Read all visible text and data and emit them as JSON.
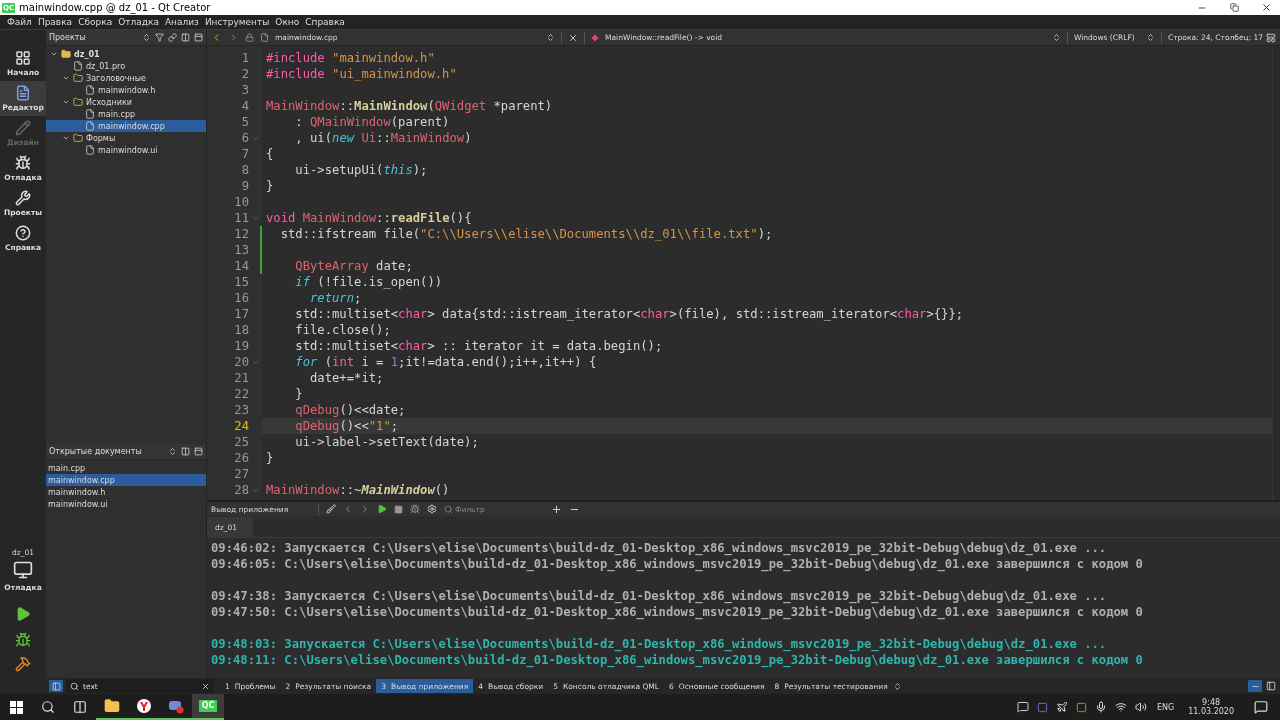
{
  "window": {
    "logo": "QC",
    "title": "mainwindow.cpp @ dz_01 - Qt Creator"
  },
  "menu": [
    "Файл",
    "Правка",
    "Сборка",
    "Отладка",
    "Анализ",
    "Инструменты",
    "Окно",
    "Справка"
  ],
  "modes": [
    {
      "kind": "welcome",
      "label": "Начало",
      "selected": false,
      "disabled": false
    },
    {
      "kind": "edit",
      "label": "Редактор",
      "selected": true,
      "disabled": false
    },
    {
      "kind": "design",
      "label": "Дизайн",
      "selected": false,
      "disabled": true
    },
    {
      "kind": "debug",
      "label": "Отладка",
      "selected": false,
      "disabled": false
    },
    {
      "kind": "projects",
      "label": "Проекты",
      "selected": false,
      "disabled": false
    },
    {
      "kind": "help",
      "label": "Справка",
      "selected": false,
      "disabled": false
    }
  ],
  "kit": {
    "project": "dz_01",
    "build": "Отладка"
  },
  "project_panel": {
    "title": "Проекты",
    "tree": [
      {
        "label": "dz_01",
        "kind": "project",
        "expanded": true,
        "selected": false,
        "children": [
          {
            "label": "dz_01.pro",
            "kind": "file",
            "selected": false
          },
          {
            "label": "Заголовочные",
            "kind": "folder",
            "expanded": true,
            "selected": false,
            "children": [
              {
                "label": "mainwindow.h",
                "kind": "file",
                "selected": false
              }
            ]
          },
          {
            "label": "Исходники",
            "kind": "folder",
            "expanded": true,
            "selected": false,
            "children": [
              {
                "label": "main.cpp",
                "kind": "file",
                "selected": false
              },
              {
                "label": "mainwindow.cpp",
                "kind": "file",
                "selected": true
              }
            ]
          },
          {
            "label": "Формы",
            "kind": "folder",
            "expanded": true,
            "selected": false,
            "children": [
              {
                "label": "mainwindow.ui",
                "kind": "file",
                "selected": false
              }
            ]
          }
        ]
      }
    ]
  },
  "open_documents": {
    "title": "Открытые документы",
    "items": [
      {
        "label": "main.cpp",
        "selected": false
      },
      {
        "label": "mainwindow.cpp",
        "selected": true
      },
      {
        "label": "mainwindow.h",
        "selected": false
      },
      {
        "label": "mainwindow.ui",
        "selected": false
      }
    ]
  },
  "editor": {
    "file": "mainwindow.cpp",
    "symbol": "MainWindow::readFile() -> void",
    "line_ending": "Windows (CRLF)",
    "position": "Строка: 24, Столбец: 17",
    "lines": [
      {
        "n": "1",
        "tokens": [
          {
            "kind": "keyword",
            "text": "#include"
          },
          {
            "kind": "string",
            "text": " \"mainwindow.h\""
          }
        ]
      },
      {
        "n": "2",
        "tokens": [
          {
            "kind": "keyword",
            "text": "#include"
          },
          {
            "kind": "string",
            "text": " \"ui_mainwindow.h\""
          }
        ]
      },
      {
        "n": "3"
      },
      {
        "n": "4",
        "tokens": [
          {
            "kind": "class",
            "text": "MainWindow"
          },
          {
            "kind": "text",
            "text": "::"
          },
          {
            "kind": "function",
            "text": "MainWindow"
          },
          {
            "kind": "text",
            "text": "("
          },
          {
            "kind": "class",
            "text": "QWidget"
          },
          {
            "kind": "text",
            "text": " *parent)"
          }
        ]
      },
      {
        "n": "5",
        "tokens": [
          {
            "kind": "text",
            "text": "    : "
          },
          {
            "kind": "class",
            "text": "QMainWindow"
          },
          {
            "kind": "text",
            "text": "(parent)"
          }
        ]
      },
      {
        "n": "6",
        "foldable": true,
        "tokens": [
          {
            "kind": "text",
            "text": "    , ui("
          },
          {
            "kind": "keyword_italic",
            "text": "new"
          },
          {
            "kind": "class",
            "text": " Ui"
          },
          {
            "kind": "text",
            "text": "::"
          },
          {
            "kind": "class",
            "text": "MainWindow"
          },
          {
            "kind": "text",
            "text": ")"
          }
        ]
      },
      {
        "n": "7",
        "tokens": [
          {
            "kind": "text",
            "text": "{"
          }
        ]
      },
      {
        "n": "8",
        "tokens": [
          {
            "kind": "text",
            "text": "    ui->setupUi("
          },
          {
            "kind": "keyword_italic",
            "text": "this"
          },
          {
            "kind": "text",
            "text": ");"
          }
        ]
      },
      {
        "n": "9",
        "tokens": [
          {
            "kind": "text",
            "text": "}"
          }
        ]
      },
      {
        "n": "10"
      },
      {
        "n": "11",
        "foldable": true,
        "tokens": [
          {
            "kind": "keyword",
            "text": "void"
          },
          {
            "kind": "class",
            "text": " MainWindow"
          },
          {
            "kind": "text",
            "text": "::"
          },
          {
            "kind": "function",
            "text": "readFile"
          },
          {
            "kind": "text",
            "text": "(){"
          }
        ]
      },
      {
        "n": "12",
        "changed": true,
        "tokens": [
          {
            "kind": "text",
            "text": "  std::ifstream file("
          },
          {
            "kind": "string",
            "text": "\"C:\\\\Users\\\\elise\\\\Documents\\\\dz_01\\\\file.txt\""
          },
          {
            "kind": "text",
            "text": ");"
          }
        ]
      },
      {
        "n": "13",
        "changed": true
      },
      {
        "n": "14",
        "changed": true,
        "tokens": [
          {
            "kind": "class",
            "text": "    QByteArray"
          },
          {
            "kind": "text",
            "text": " date;"
          }
        ]
      },
      {
        "n": "15",
        "tokens": [
          {
            "kind": "keyword_italic",
            "text": "    if"
          },
          {
            "kind": "text",
            "text": " (!file.is_open())"
          }
        ]
      },
      {
        "n": "16",
        "tokens": [
          {
            "kind": "keyword_italic",
            "text": "      return"
          },
          {
            "kind": "text",
            "text": ";"
          }
        ]
      },
      {
        "n": "17",
        "tokens": [
          {
            "kind": "text",
            "text": "    std::multiset<"
          },
          {
            "kind": "keyword",
            "text": "char"
          },
          {
            "kind": "text",
            "text": "> data{std::istream_iterator<"
          },
          {
            "kind": "keyword",
            "text": "char"
          },
          {
            "kind": "text",
            "text": ">(file), std::istream_iterator<"
          },
          {
            "kind": "keyword",
            "text": "char"
          },
          {
            "kind": "text",
            "text": ">{}};"
          }
        ]
      },
      {
        "n": "18",
        "tokens": [
          {
            "kind": "text",
            "text": "    file.close();"
          }
        ]
      },
      {
        "n": "19",
        "tokens": [
          {
            "kind": "text",
            "text": "    std::multiset<"
          },
          {
            "kind": "keyword",
            "text": "char"
          },
          {
            "kind": "text",
            "text": "> :: iterator it = data.begin();"
          }
        ]
      },
      {
        "n": "20",
        "foldable": true,
        "tokens": [
          {
            "kind": "keyword_italic",
            "text": "    for"
          },
          {
            "kind": "text",
            "text": " ("
          },
          {
            "kind": "keyword",
            "text": "int"
          },
          {
            "kind": "text",
            "text": " i = "
          },
          {
            "kind": "number",
            "text": "1"
          },
          {
            "kind": "text",
            "text": ";it!=data.end();i++,it++) {"
          }
        ]
      },
      {
        "n": "21",
        "tokens": [
          {
            "kind": "text",
            "text": "      date+=*it;"
          }
        ]
      },
      {
        "n": "22",
        "tokens": [
          {
            "kind": "text",
            "text": "    }"
          }
        ]
      },
      {
        "n": "23",
        "tokens": [
          {
            "kind": "class",
            "text": "    qDebug"
          },
          {
            "kind": "text",
            "text": "()<<date;"
          }
        ]
      },
      {
        "n": "24",
        "current": true,
        "tokens": [
          {
            "kind": "class",
            "text": "    qDebug"
          },
          {
            "kind": "text",
            "text": "()<<"
          },
          {
            "kind": "string",
            "text": "\"1\""
          },
          {
            "kind": "text",
            "text": ";"
          }
        ]
      },
      {
        "n": "25",
        "tokens": [
          {
            "kind": "text",
            "text": "    ui->label->setText(date);"
          }
        ]
      },
      {
        "n": "26",
        "tokens": [
          {
            "kind": "text",
            "text": "}"
          }
        ]
      },
      {
        "n": "27"
      },
      {
        "n": "28",
        "foldable": true,
        "tokens": [
          {
            "kind": "class",
            "text": "MainWindow"
          },
          {
            "kind": "text",
            "text": "::~"
          },
          {
            "kind": "function_italic",
            "text": "MainWindow"
          },
          {
            "kind": "text",
            "text": "()"
          }
        ]
      }
    ]
  },
  "output": {
    "title": "Вывод приложения",
    "filter_placeholder": "Фильтр",
    "tab": "dz_01",
    "groups": [
      {
        "latest": false,
        "lines": [
          "09:46:02: Запускается C:\\Users\\elise\\Documents\\build-dz_01-Desktop_x86_windows_msvc2019_pe_32bit-Debug\\debug\\dz_01.exe ...",
          "09:46:05: C:\\Users\\elise\\Documents\\build-dz_01-Desktop_x86_windows_msvc2019_pe_32bit-Debug\\debug\\dz_01.exe завершился с кодом 0"
        ]
      },
      {
        "latest": false,
        "lines": [
          "09:47:38: Запускается C:\\Users\\elise\\Documents\\build-dz_01-Desktop_x86_windows_msvc2019_pe_32bit-Debug\\debug\\dz_01.exe ...",
          "09:47:50: C:\\Users\\elise\\Documents\\build-dz_01-Desktop_x86_windows_msvc2019_pe_32bit-Debug\\debug\\dz_01.exe завершился с кодом 0"
        ]
      },
      {
        "latest": true,
        "lines": [
          "09:48:03: Запускается C:\\Users\\elise\\Documents\\build-dz_01-Desktop_x86_windows_msvc2019_pe_32bit-Debug\\debug\\dz_01.exe ...",
          "09:48:11: C:\\Users\\elise\\Documents\\build-dz_01-Desktop_x86_windows_msvc2019_pe_32bit-Debug\\debug\\dz_01.exe завершился с кодом 0"
        ]
      }
    ]
  },
  "locator": {
    "value": "text"
  },
  "panes": [
    {
      "number": "1",
      "label": "Проблемы",
      "selected": false
    },
    {
      "number": "2",
      "label": "Результаты поиска",
      "selected": false
    },
    {
      "number": "3",
      "label": "Вывод приложения",
      "selected": true
    },
    {
      "number": "4",
      "label": "Вывод сборки",
      "selected": false
    },
    {
      "number": "5",
      "label": "Консоль отладчика QML",
      "selected": false
    },
    {
      "number": "6",
      "label": "Основные сообщения",
      "selected": false
    },
    {
      "number": "8",
      "label": "Результаты тестирования",
      "selected": false
    }
  ],
  "taskbar": {
    "apps": [
      {
        "kind": "explorer",
        "active": false
      },
      {
        "kind": "browser",
        "active": false
      },
      {
        "kind": "chat",
        "active": false
      },
      {
        "kind": "qt",
        "active": true,
        "logo": "QC"
      }
    ],
    "language": "ENG",
    "time": "9:48",
    "date": "11.03.2020"
  }
}
